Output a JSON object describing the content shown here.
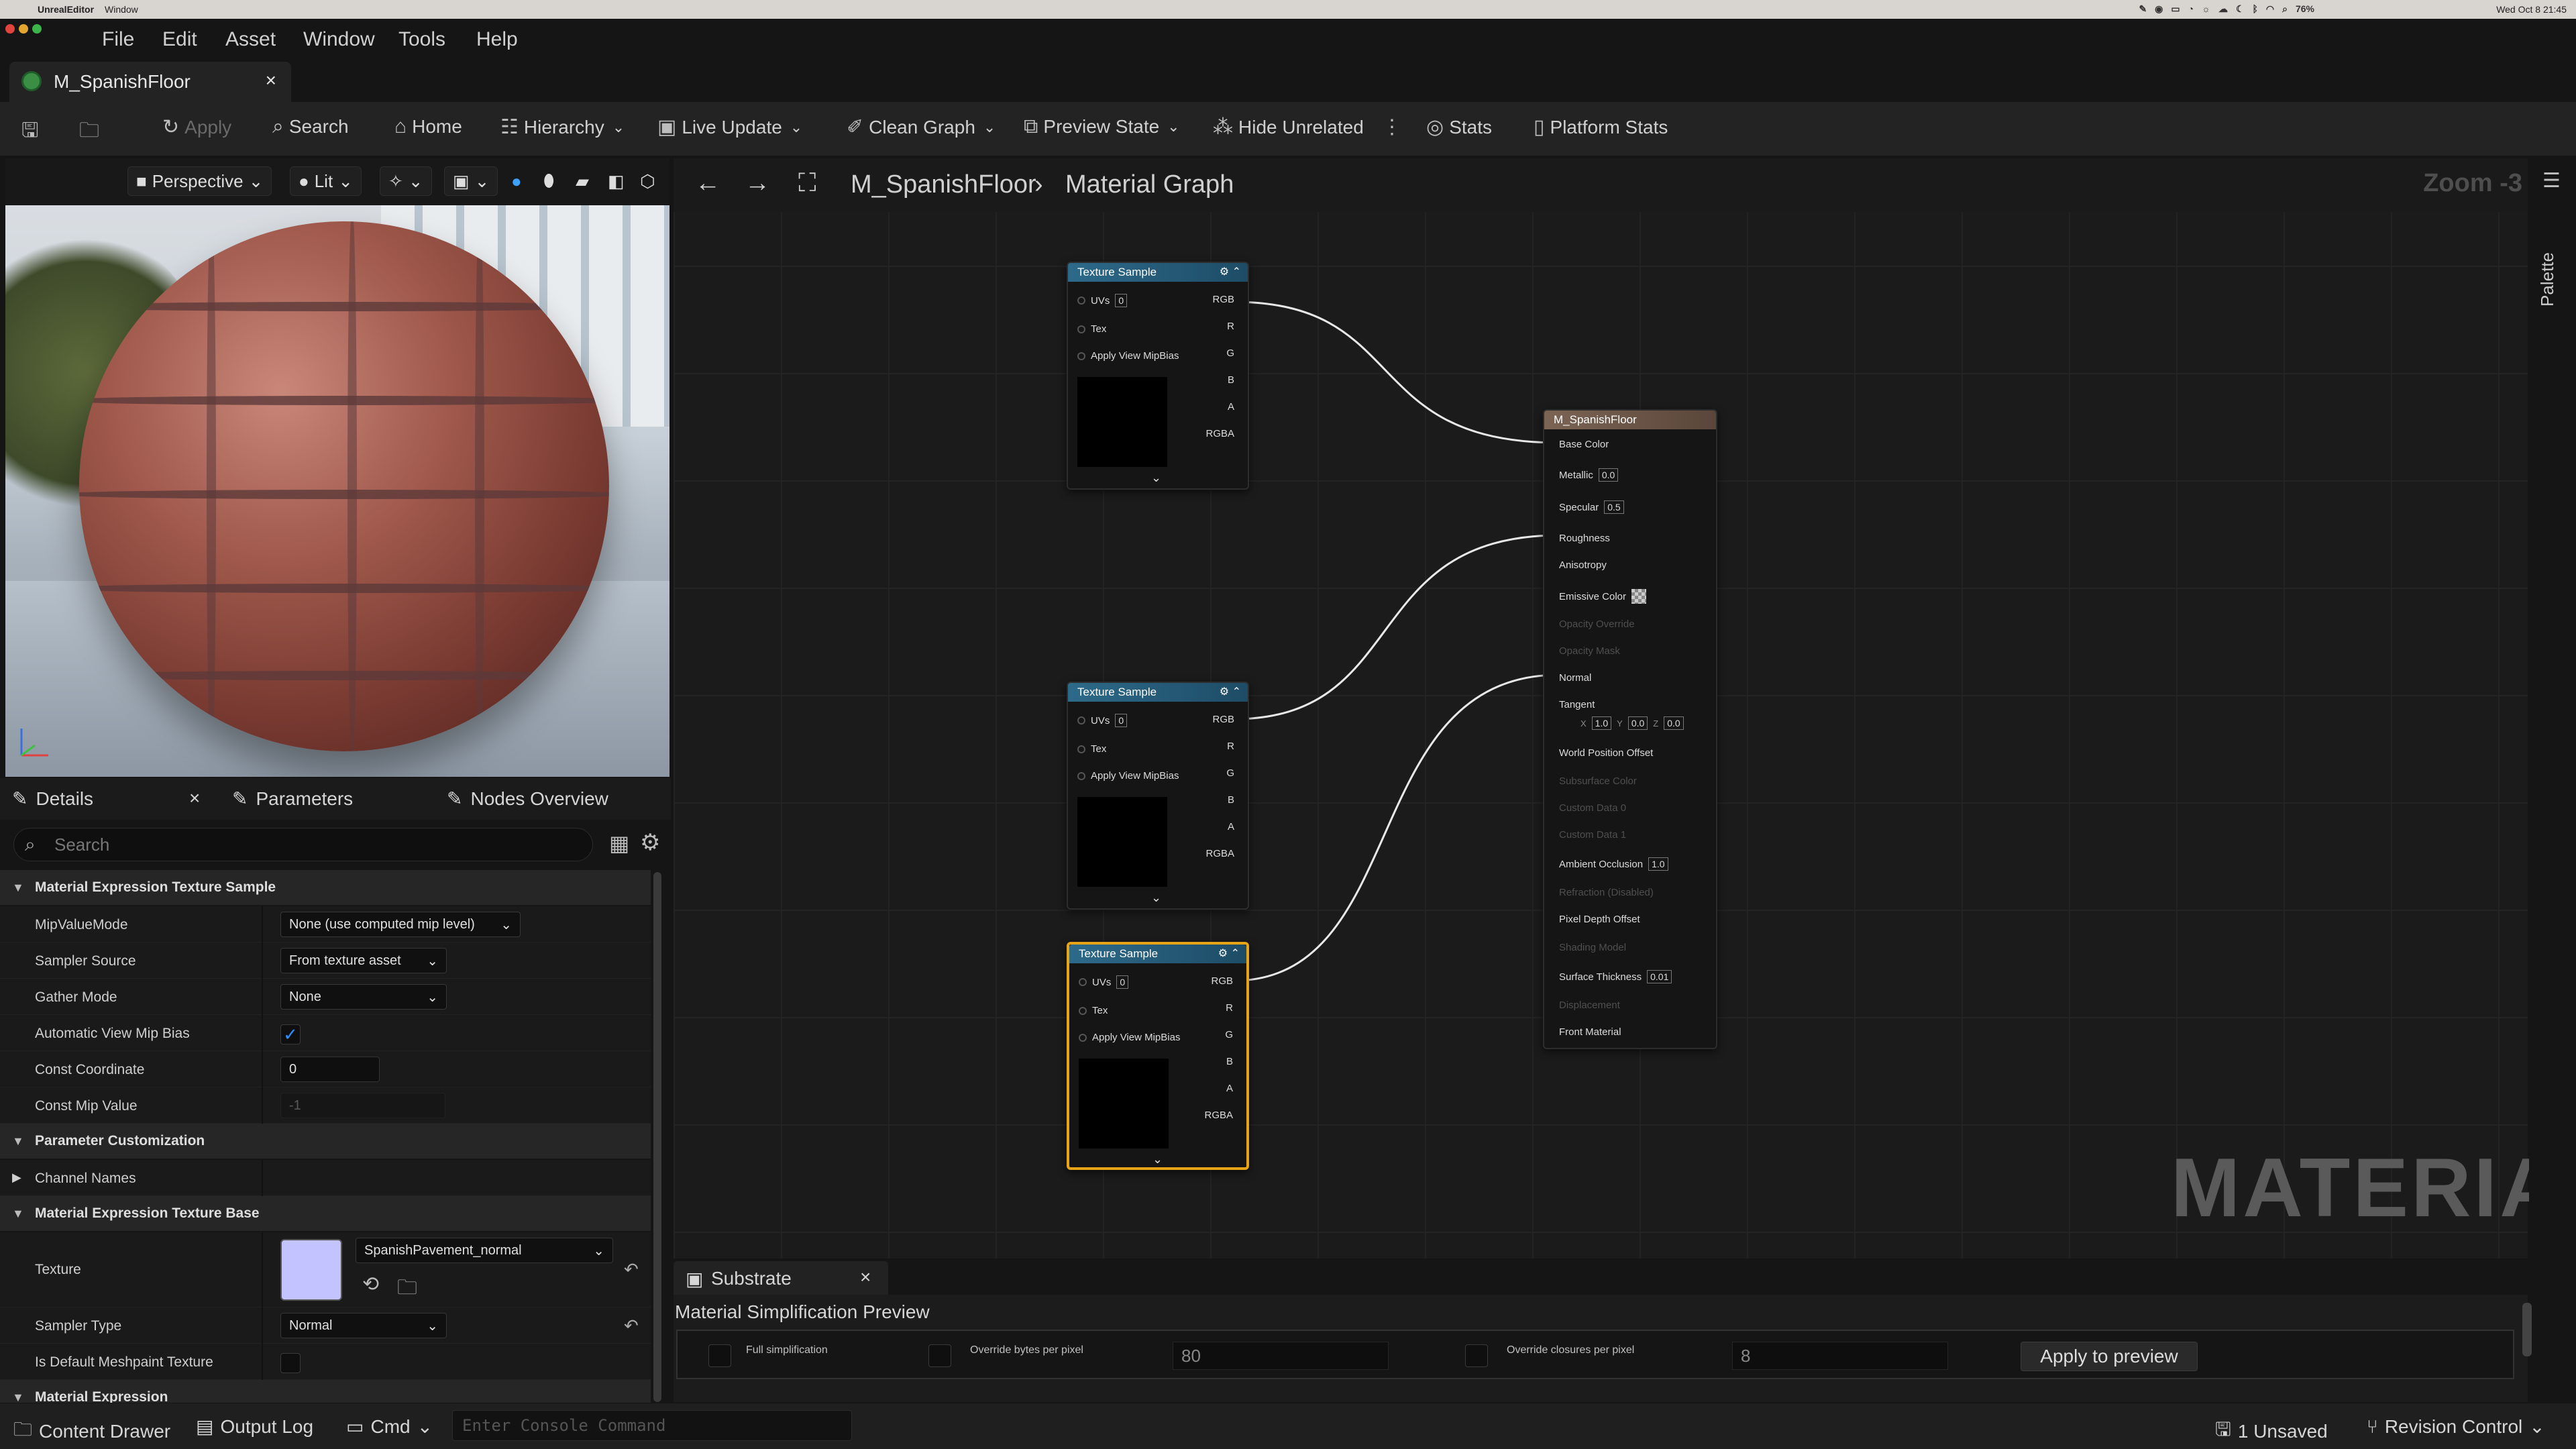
{
  "mac": {
    "app": "UnrealEditor",
    "window": "Window",
    "battery": "76%",
    "clock": "Wed Oct 8  21:45"
  },
  "menu": [
    "File",
    "Edit",
    "Asset",
    "Window",
    "Tools",
    "Help"
  ],
  "doc_tab": {
    "title": "M_SpanishFloor",
    "close": "×"
  },
  "toolbar": {
    "apply": "Apply",
    "search": "Search",
    "home": "Home",
    "hierarchy": "Hierarchy",
    "live_update": "Live Update",
    "clean_graph": "Clean Graph",
    "preview_state": "Preview State",
    "hide_unrelated": "Hide Unrelated",
    "stats": "Stats",
    "platform_stats": "Platform Stats"
  },
  "viewport": {
    "perspective": "Perspective",
    "lit": "Lit"
  },
  "details": {
    "tabs": [
      "Details",
      "Parameters",
      "Nodes Overview"
    ],
    "search_placeholder": "Search",
    "sections": {
      "s1": "Material Expression Texture Sample",
      "s2": "Parameter Customization",
      "s3": "Material Expression Texture Base",
      "s4": "Material Expression"
    },
    "rows": {
      "mip_value_mode": {
        "label": "MipValueMode",
        "value": "None (use computed mip level)"
      },
      "sampler_source": {
        "label": "Sampler Source",
        "value": "From texture asset"
      },
      "gather_mode": {
        "label": "Gather Mode",
        "value": "None"
      },
      "auto_view_mip_bias": {
        "label": "Automatic View Mip Bias",
        "checked": true
      },
      "const_coordinate": {
        "label": "Const Coordinate",
        "value": "0"
      },
      "const_mip_value": {
        "label": "Const Mip Value",
        "value": "-1"
      },
      "channel_names": {
        "label": "Channel Names"
      },
      "texture": {
        "label": "Texture",
        "value": "SpanishPavement_normal",
        "swatch": "#c3c3ff"
      },
      "sampler_type": {
        "label": "Sampler Type",
        "value": "Normal"
      },
      "is_default_meshpaint": {
        "label": "Is Default Meshpaint Texture",
        "checked": false
      }
    }
  },
  "graph": {
    "breadcrumb": {
      "asset": "M_SpanishFloor",
      "graph": "Material Graph"
    },
    "zoom": "Zoom -3",
    "watermark": "MATERIAL",
    "texture_node": {
      "title": "Texture Sample",
      "inputs": [
        "UVs",
        "Tex",
        "Apply View MipBias"
      ],
      "uv_value": "0",
      "outputs": [
        "RGB",
        "R",
        "G",
        "B",
        "A",
        "RGBA"
      ],
      "output_colors": [
        "#e8e8e8",
        "#e03030",
        "#30c040",
        "#2040e0",
        "#c8c8c8",
        "#e8e8e8"
      ]
    },
    "material_node": {
      "title": "M_SpanishFloor",
      "pins": {
        "base_color": "Base Color",
        "metallic": "Metallic",
        "metallic_val": "0.0",
        "specular": "Specular",
        "specular_val": "0.5",
        "roughness": "Roughness",
        "anisotropy": "Anisotropy",
        "emissive": "Emissive Color",
        "opacity_override": "Opacity Override",
        "opacity_mask": "Opacity Mask",
        "normal": "Normal",
        "tangent": "Tangent",
        "tx": "1.0",
        "ty": "0.0",
        "tz": "0.0",
        "wpo": "World Position Offset",
        "subsurface": "Subsurface Color",
        "custom0": "Custom Data 0",
        "custom1": "Custom Data 1",
        "ao": "Ambient Occlusion",
        "ao_val": "1.0",
        "refraction": "Refraction (Disabled)",
        "pdo": "Pixel Depth Offset",
        "shading_model": "Shading Model",
        "surface_thickness": "Surface Thickness",
        "st_val": "0.01",
        "displacement": "Displacement",
        "front_material": "Front Material"
      }
    }
  },
  "substrate": {
    "tab": "Substrate",
    "title": "Material Simplification Preview",
    "full": "Full simplification",
    "bytes_label": "Override bytes per pixel",
    "bytes_value": "80",
    "closures_label": "Override closures per pixel",
    "closures_value": "8",
    "apply": "Apply to preview"
  },
  "palette": "Palette",
  "status": {
    "content_drawer": "Content Drawer",
    "output_log": "Output Log",
    "cmd": "Cmd",
    "console_placeholder": "Enter Console Command",
    "unsaved": "1 Unsaved",
    "revision": "Revision Control"
  }
}
